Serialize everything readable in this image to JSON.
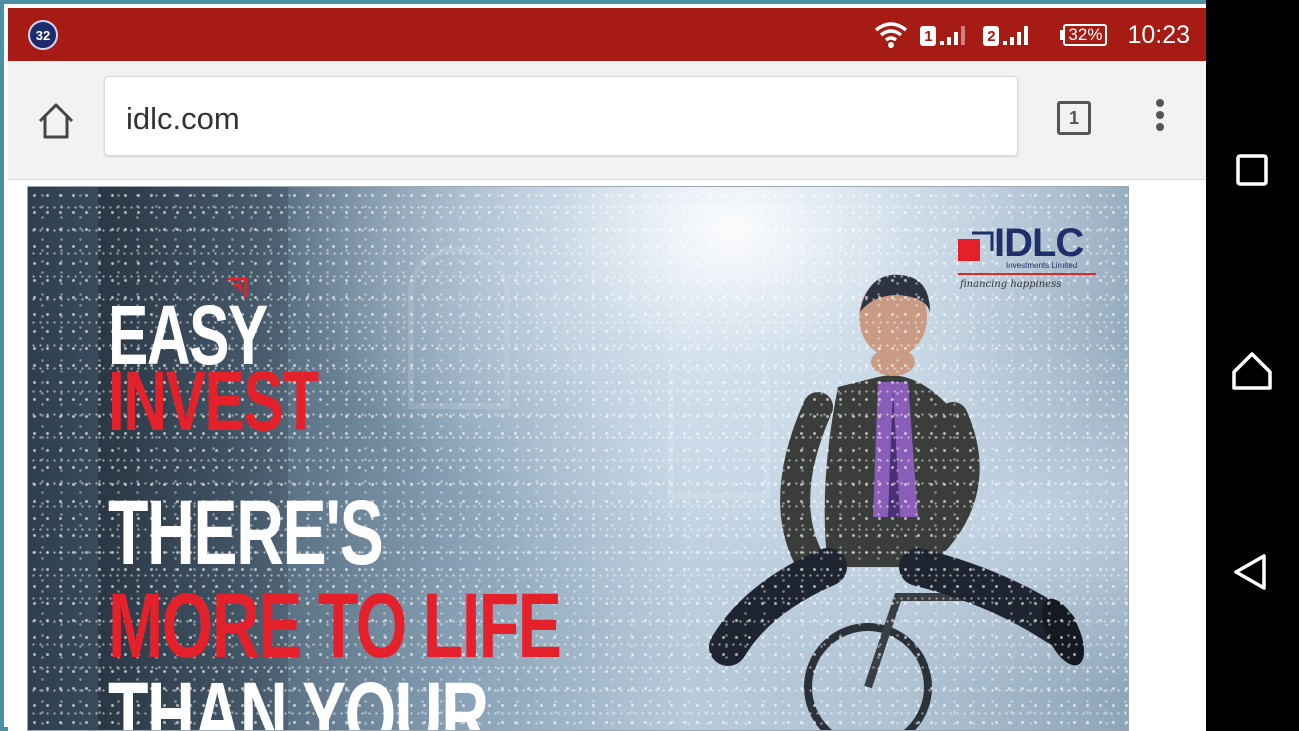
{
  "statusbar": {
    "notification_count": "32",
    "sim1": "1",
    "sim2": "2",
    "battery": "32%",
    "time": "10:23",
    "icons": [
      "wifi-icon",
      "signal-icon",
      "battery-icon"
    ]
  },
  "toolbar": {
    "url": "idlc.com",
    "tab_count": "1",
    "icons": [
      "home-icon",
      "tab-switcher-icon",
      "overflow-menu-icon"
    ]
  },
  "banner": {
    "line_easy": "EASY",
    "line_invest": "INVEST",
    "line_theres": "THERE'S",
    "line_more": "MORE TO LIFE",
    "line_than": "THAN YOUR",
    "logo": {
      "name": "IDLC",
      "subtitle": "Investments Limited",
      "tagline": "financing happiness"
    },
    "colors": {
      "red": "#e4212b",
      "navy": "#1e2f6a"
    }
  },
  "navbar": {
    "icons": [
      "recent-apps-icon",
      "home-icon",
      "back-icon"
    ]
  },
  "colors": {
    "statusbar": "#a61c15",
    "toolbar": "#f2f2f2",
    "navbar": "#000000"
  }
}
